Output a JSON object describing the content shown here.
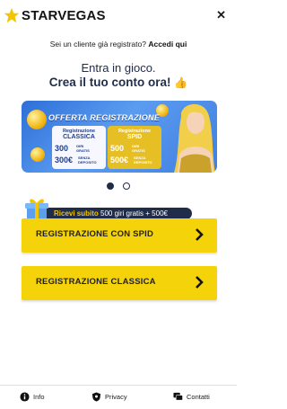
{
  "brand": {
    "name": "STARVEGAS",
    "accent": "#f5d30a",
    "navy": "#1f2d4a"
  },
  "header": {
    "close_icon": "✕"
  },
  "login": {
    "question": "Sei un cliente già registrato?",
    "link": "Accedi qui"
  },
  "hero": {
    "line1": "Entra in gioco.",
    "line2": "Crea il tuo conto ora!",
    "emoji": "👍"
  },
  "banner": {
    "title": "OFFERTA REGISTRAZIONE",
    "classica": {
      "heading1": "Registrazione",
      "heading2": "CLASSICA",
      "v1": "300",
      "d1a": "GIRI",
      "d1b": "GRATIS",
      "v2": "300€",
      "d2a": "SENZA",
      "d2b": "DEPOSITO"
    },
    "spid": {
      "heading1": "Registrazione",
      "heading2": "SPID",
      "v1": "500",
      "d1a": "GIRI",
      "d1b": "GRATIS",
      "v2": "500€",
      "d2a": "SENZA",
      "d2b": "DEPOSITO"
    }
  },
  "carousel": {
    "active": 0,
    "count": 2
  },
  "promo": {
    "prefix": "Ricevi subito",
    "offer": "500 giri gratis + 500€"
  },
  "buttons": {
    "spid": "REGISTRAZIONE CON SPID",
    "classica": "REGISTRAZIONE CLASSICA"
  },
  "footer": {
    "info": "Info",
    "privacy": "Privacy",
    "contatti": "Contatti"
  }
}
